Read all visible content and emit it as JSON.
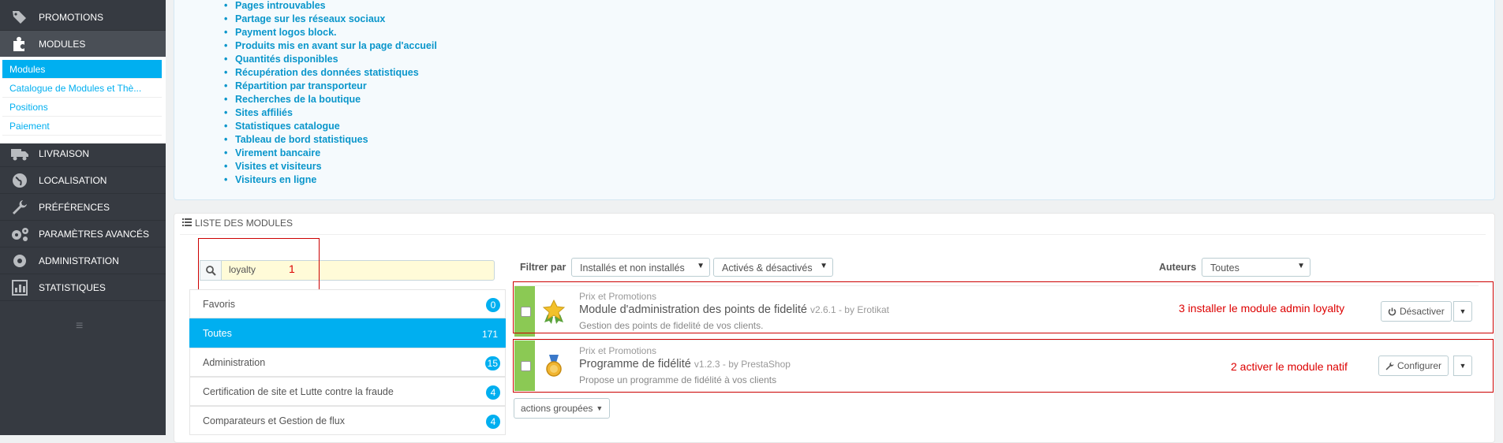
{
  "sidebar": {
    "main_items": [
      {
        "label": "PROMOTIONS",
        "icon": "tag-icon"
      },
      {
        "label": "MODULES",
        "icon": "puzzle-icon"
      },
      {
        "label": "LIVRAISON",
        "icon": "truck-icon"
      },
      {
        "label": "LOCALISATION",
        "icon": "globe-icon"
      },
      {
        "label": "PRÉFÉRENCES",
        "icon": "wrench-icon"
      },
      {
        "label": "PARAMÈTRES AVANCÉS",
        "icon": "gears-icon"
      },
      {
        "label": "ADMINISTRATION",
        "icon": "gear-icon"
      },
      {
        "label": "STATISTIQUES",
        "icon": "bar-chart-icon"
      }
    ],
    "sub_items": [
      "Modules",
      "Catalogue de Modules et Thè...",
      "Positions",
      "Paiement"
    ]
  },
  "top_list": [
    "Pages introuvables",
    "Partage sur les réseaux sociaux",
    "Payment logos block.",
    "Produits mis en avant sur la page d'accueil",
    "Quantités disponibles",
    "Récupération des données statistiques",
    "Répartition par transporteur",
    "Recherches de la boutique",
    "Sites affiliés",
    "Statistiques catalogue",
    "Tableau de bord statistiques",
    "Virement bancaire",
    "Visites et visiteurs",
    "Visiteurs en ligne"
  ],
  "module_list": {
    "title": "LISTE DES MODULES",
    "search_value": "loyalty",
    "annotation_1": "1"
  },
  "categories": [
    {
      "label": "Favoris",
      "count": "0"
    },
    {
      "label": "Toutes",
      "count": "171"
    },
    {
      "label": "Administration",
      "count": "15"
    },
    {
      "label": "Certification de site et Lutte contre la fraude",
      "count": "4"
    },
    {
      "label": "Comparateurs et Gestion de flux",
      "count": "4"
    }
  ],
  "filters": {
    "label": "Filtrer par",
    "install_value": "Installés et non installés",
    "active_value": "Activés & désactivés",
    "authors_label": "Auteurs",
    "authors_value": "Toutes"
  },
  "modules": [
    {
      "category": "Prix et Promotions",
      "name": "Module d'administration des points de fidelité",
      "version": "v2.6.1 - by Erotikat",
      "description": "Gestion des points de fidelité de vos clients.",
      "action": "Désactiver",
      "note": "3 installer le module admin loyalty"
    },
    {
      "category": "Prix et Promotions",
      "name": "Programme de fidélité",
      "version": "v1.2.3 - by PrestaShop",
      "description": "Propose un programme de fidélité à vos clients",
      "action": "Configurer",
      "note": "2 activer le module natif"
    }
  ],
  "bulk_actions": "actions groupées",
  "colors": {
    "sidebar": "#363a41",
    "accent": "#00aff0",
    "link": "#0a96cb",
    "status_bar": "#8bc954",
    "annotation": "#cc0000"
  }
}
